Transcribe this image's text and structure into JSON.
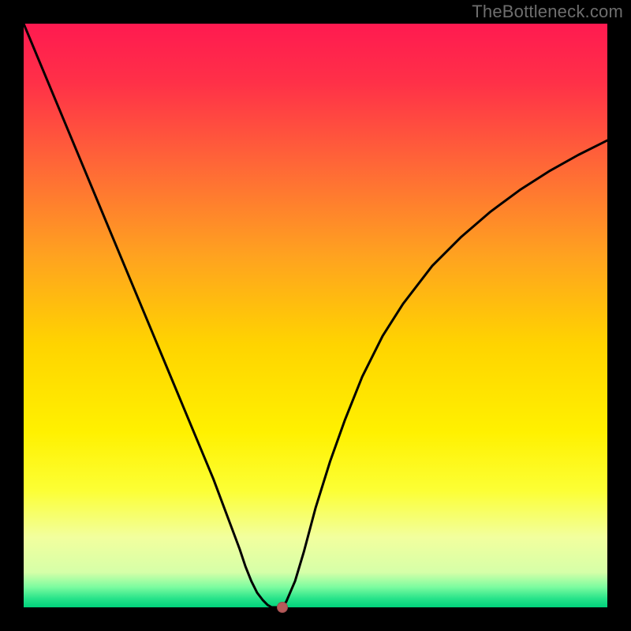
{
  "watermark": "TheBottleneck.com",
  "chart_data": {
    "type": "line",
    "title": "",
    "xlabel": "",
    "ylabel": "",
    "xlim": [
      0,
      100
    ],
    "ylim": [
      0,
      100
    ],
    "background_gradient": {
      "stops": [
        {
          "offset": 0.0,
          "color": "#ff1a50"
        },
        {
          "offset": 0.1,
          "color": "#ff3048"
        },
        {
          "offset": 0.25,
          "color": "#ff6a36"
        },
        {
          "offset": 0.4,
          "color": "#ffa31f"
        },
        {
          "offset": 0.55,
          "color": "#ffd400"
        },
        {
          "offset": 0.7,
          "color": "#fff100"
        },
        {
          "offset": 0.8,
          "color": "#fcff35"
        },
        {
          "offset": 0.88,
          "color": "#f2ff9e"
        },
        {
          "offset": 0.94,
          "color": "#d6ffa8"
        },
        {
          "offset": 0.965,
          "color": "#7dfca0"
        },
        {
          "offset": 0.985,
          "color": "#27e38a"
        },
        {
          "offset": 1.0,
          "color": "#00d27b"
        }
      ]
    },
    "series": [
      {
        "name": "bottleneck-curve",
        "x": [
          0.0,
          2.5,
          5.0,
          7.5,
          10.0,
          12.5,
          15.0,
          17.5,
          20.0,
          22.5,
          25.0,
          27.5,
          30.0,
          32.5,
          34.0,
          35.5,
          37.0,
          38.0,
          39.0,
          40.0,
          41.0,
          41.8,
          42.5,
          44.3,
          45.0,
          46.5,
          48.0,
          50.0,
          52.5,
          55.0,
          58.0,
          61.5,
          65.0,
          70.0,
          75.0,
          80.0,
          85.0,
          90.0,
          95.0,
          100.0
        ],
        "y": [
          100.0,
          94.0,
          88.0,
          82.0,
          76.0,
          70.0,
          64.0,
          58.0,
          52.0,
          46.0,
          40.0,
          34.0,
          28.0,
          22.0,
          18.0,
          14.0,
          10.0,
          7.0,
          4.5,
          2.5,
          1.2,
          0.4,
          0.0,
          0.0,
          1.0,
          4.5,
          9.5,
          17.0,
          25.0,
          32.0,
          39.5,
          46.5,
          52.0,
          58.5,
          63.5,
          67.8,
          71.5,
          74.7,
          77.5,
          80.0
        ]
      }
    ],
    "marker": {
      "x": 44.3,
      "y": 0.0,
      "color": "#b65a5a"
    },
    "grid": false,
    "legend": false
  }
}
